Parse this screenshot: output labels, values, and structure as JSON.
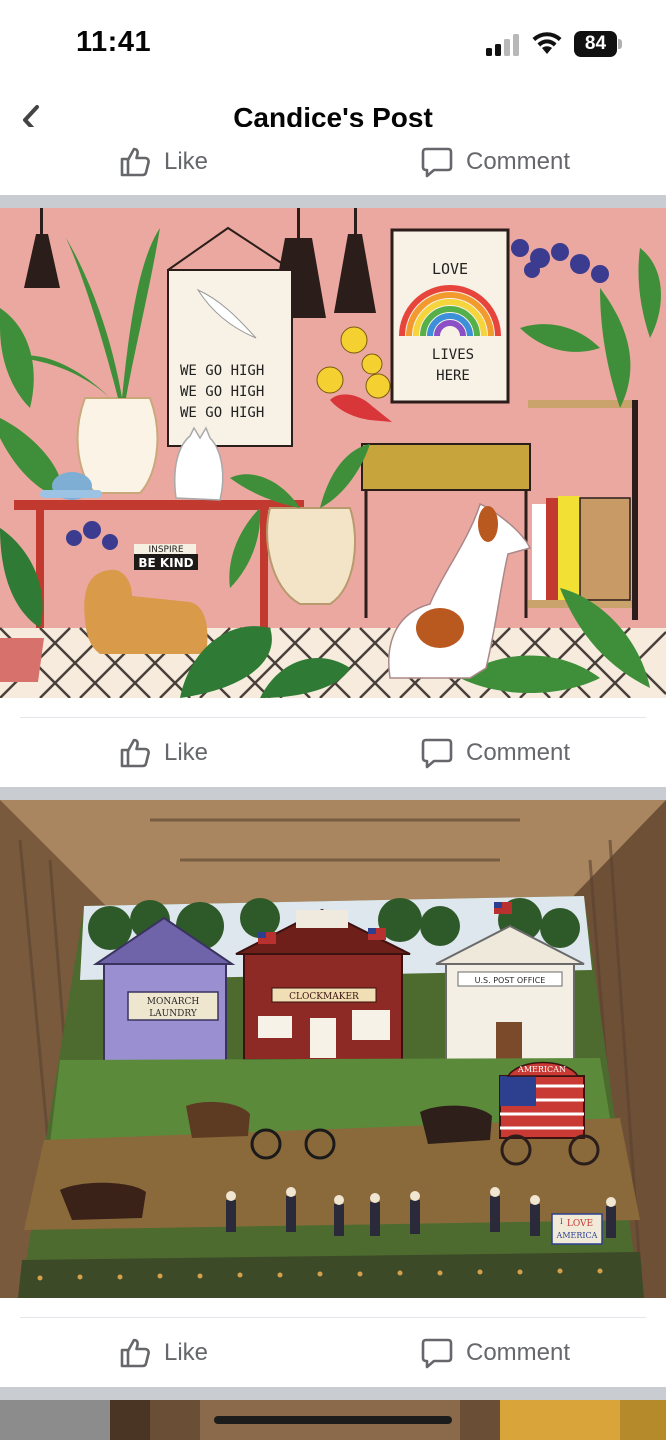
{
  "status_bar": {
    "time": "11:41",
    "battery": "84"
  },
  "nav": {
    "title": "Candice's Post"
  },
  "actions": {
    "like": "Like",
    "comment": "Comment"
  },
  "puzzle1": {
    "poster_left": [
      "WE GO HIGH",
      "WE GO HIGH",
      "WE GO HIGH"
    ],
    "poster_right_top": "LOVE",
    "poster_right_bottom": [
      "LIVES",
      "HERE"
    ],
    "sign_small": "INSPIRE",
    "sign_big": "BE KIND"
  },
  "puzzle2": {
    "laundry": [
      "MONARCH",
      "LAUNDRY"
    ],
    "clockmaker": "CLOCKMAKER",
    "post_office": "U.S. POST OFFICE",
    "wagon": "AMERICAN",
    "sign": [
      "I",
      "LOVE",
      "AMERICA"
    ]
  },
  "colors": {
    "accent_gray": "#65676b",
    "puzzle1_bg": "#eba8a0",
    "divider": "#c9ccd1"
  }
}
